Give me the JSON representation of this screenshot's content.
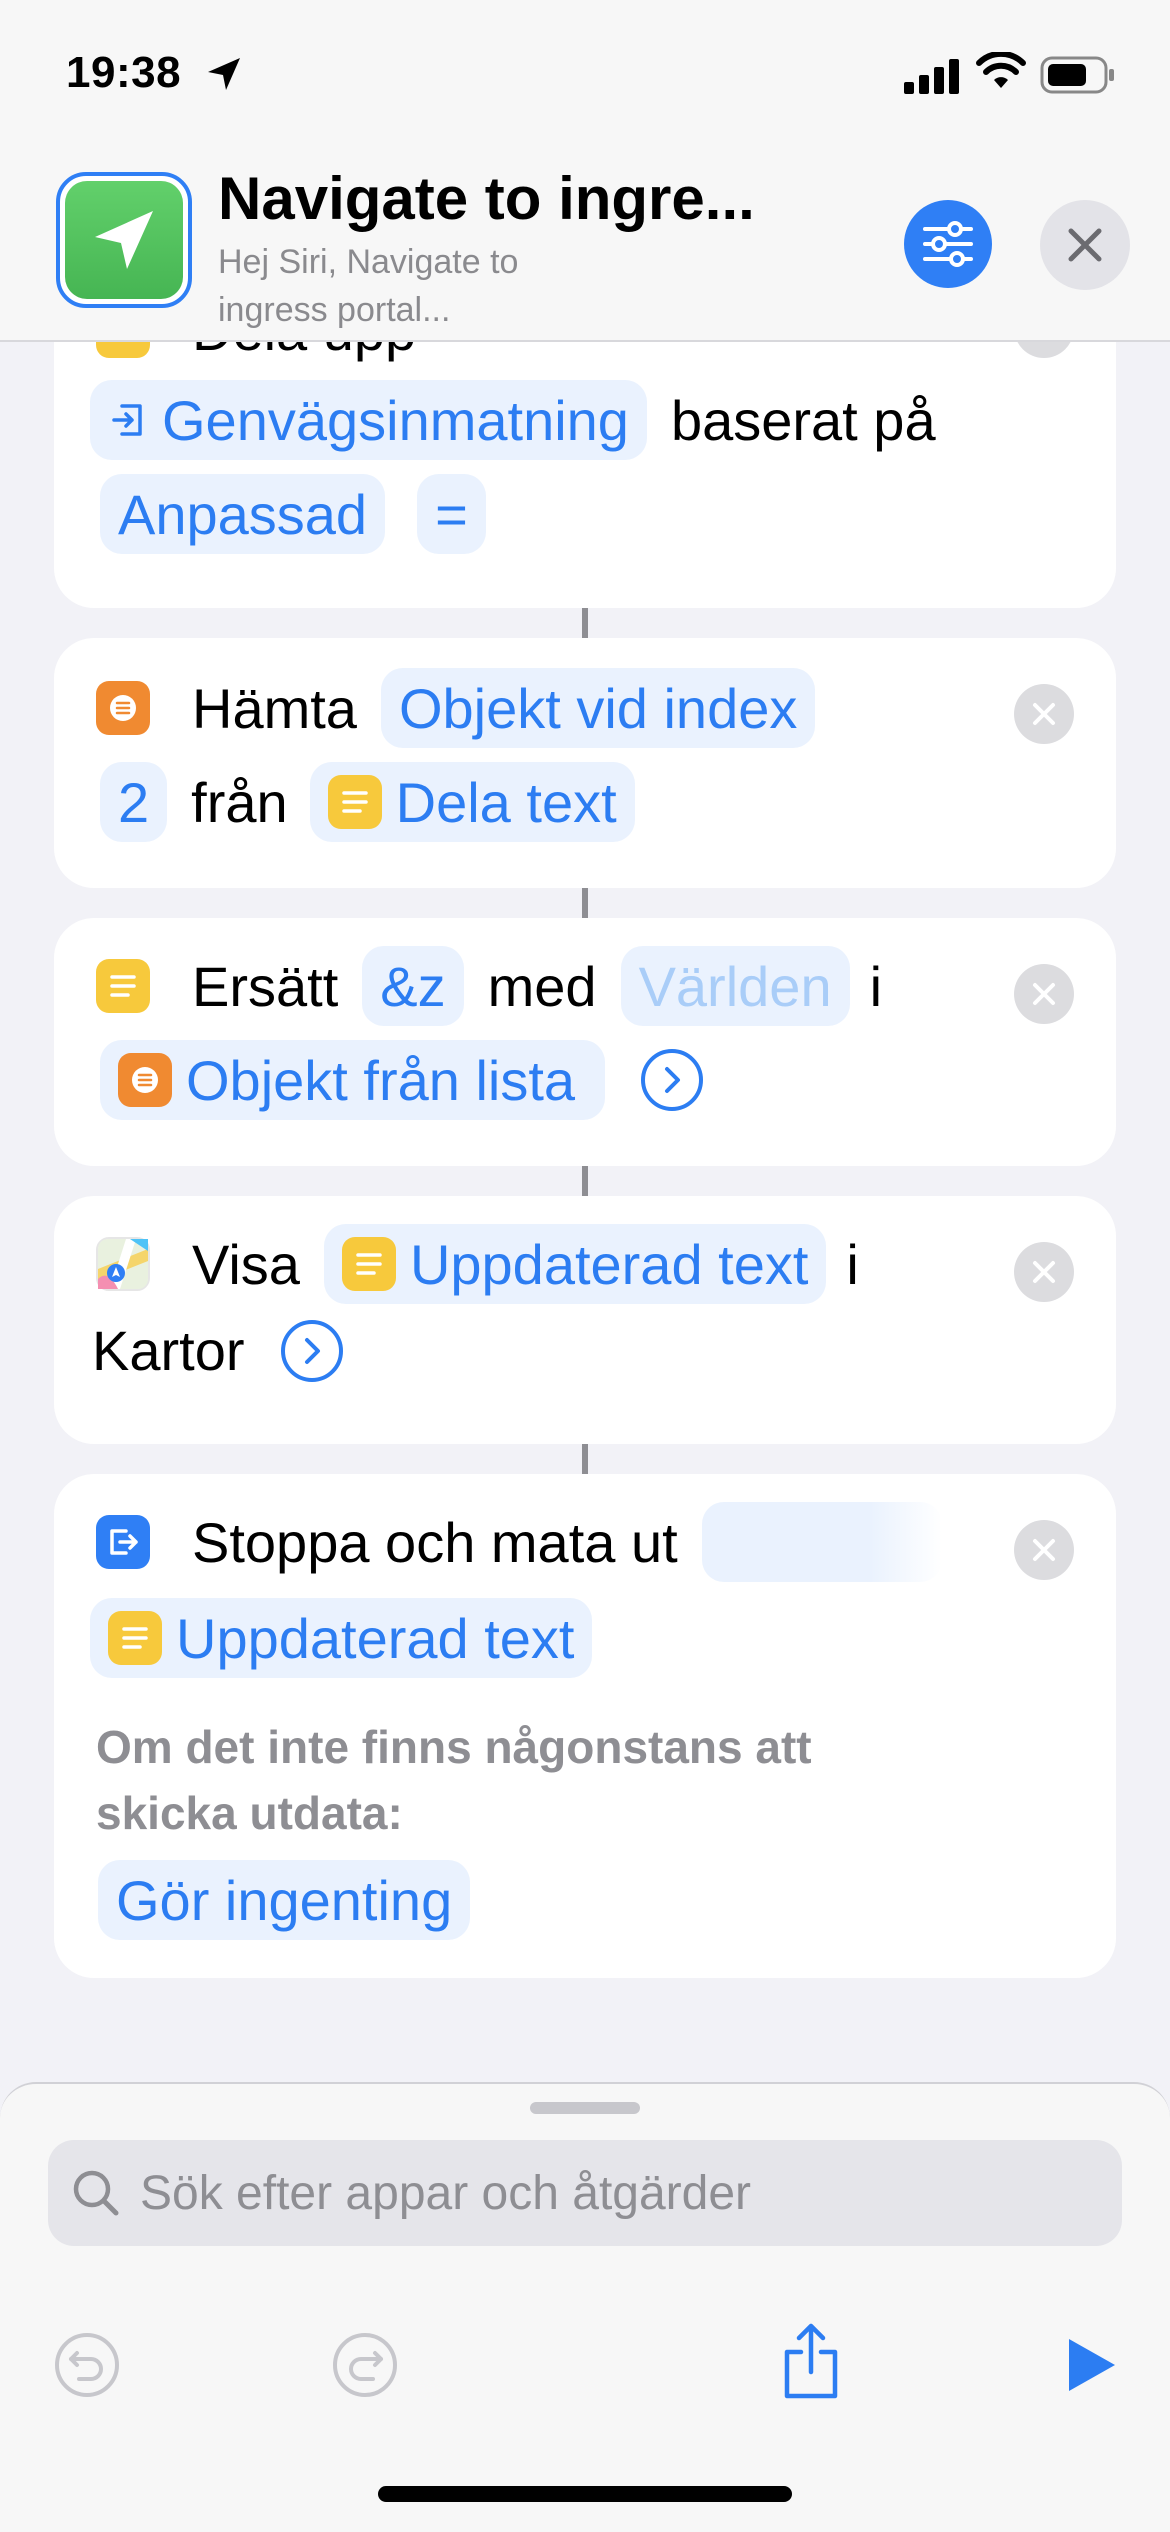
{
  "status_bar": {
    "time": "19:38"
  },
  "header": {
    "title": "Navigate to ingre...",
    "subtitle": "Hej Siri, Navigate to ingress portal..."
  },
  "actions": {
    "split": {
      "label": "Dela upp",
      "input_token": "Genvägsinmatning",
      "based_on": "baserat på",
      "mode_token": "Anpassad",
      "separator_token": "="
    },
    "get_item": {
      "label": "Hämta",
      "token": "Objekt vid index",
      "index_token": "2",
      "from": "från",
      "source_token": "Dela text"
    },
    "replace": {
      "label": "Ersätt",
      "find_token": "&z",
      "with": "med",
      "replace_token": "Världen",
      "in": "i",
      "input_token": "Objekt från lista"
    },
    "show_maps": {
      "label": "Visa",
      "token": "Uppdaterad text",
      "in": "i",
      "app": "Kartor"
    },
    "stop_output": {
      "label": "Stoppa och mata ut",
      "token": "Uppdaterad text",
      "fallback_label": "Om det inte finns någonstans att skicka utdata:",
      "fallback_token": "Gör ingenting"
    }
  },
  "search": {
    "placeholder": "Sök efter appar och åtgärder"
  },
  "colors": {
    "accent": "#2c7df2",
    "token_bg": "#eaf2fe",
    "text_icon": "#f7c93c",
    "list_icon": "#f08a31",
    "app_icon": "#55c35f"
  }
}
